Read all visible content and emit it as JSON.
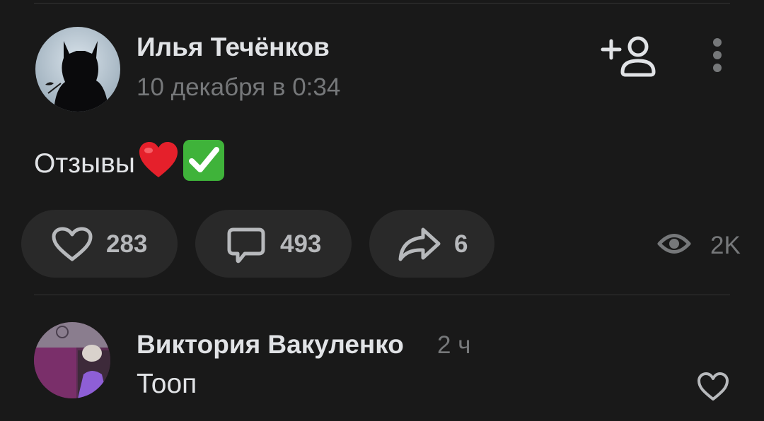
{
  "post": {
    "author_name": "Илья Течёнков",
    "date": "10 декабря в 0:34",
    "text": "Отзывы",
    "emojis": [
      "heart",
      "check-mark-button"
    ],
    "likes_count": "283",
    "comments_count": "493",
    "shares_count": "6",
    "views_count": "2K"
  },
  "comment": {
    "author_name": "Виктория Вакуленко",
    "time": "2 ч",
    "text": "Тооп"
  },
  "colors": {
    "background": "#191919",
    "pill_background": "#292929",
    "primary_text": "#e1e3e6",
    "secondary_text": "#76787a",
    "icon_color": "#b7b9bc",
    "divider": "#333333"
  },
  "icons": [
    "add-friend-icon",
    "more-vertical-icon",
    "heart-icon",
    "comment-icon",
    "share-icon",
    "eye-icon"
  ]
}
